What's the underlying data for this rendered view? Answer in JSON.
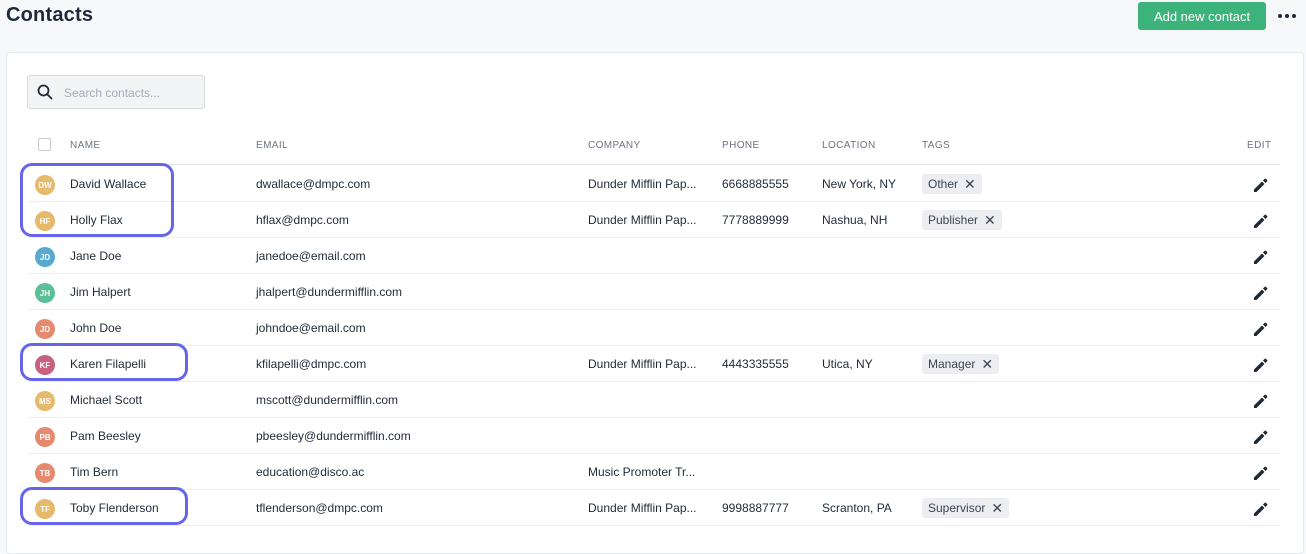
{
  "page": {
    "title": "Contacts"
  },
  "header": {
    "add_button": "Add new contact",
    "more_icon": "ellipsis-icon"
  },
  "search": {
    "placeholder": "Search contacts...",
    "value": "",
    "icon": "search-icon"
  },
  "columns": {
    "name": "NAME",
    "email": "EMAIL",
    "company": "COMPANY",
    "phone": "PHONE",
    "location": "LOCATION",
    "tags": "TAGS",
    "edit": "EDIT"
  },
  "colors": {
    "accent": "#3bb37a",
    "highlight": "#6567e6"
  },
  "contacts": [
    {
      "initials": "DW",
      "name": "David Wallace",
      "email": "dwallace@dmpc.com",
      "company": "Dunder Mifflin Pap...",
      "phone": "6668885555",
      "location": "New York, NY",
      "tag": "Other",
      "avatar_color": "#e7b96a",
      "highlighted": true
    },
    {
      "initials": "HF",
      "name": "Holly Flax",
      "email": "hflax@dmpc.com",
      "company": "Dunder Mifflin Pap...",
      "phone": "7778889999",
      "location": "Nashua, NH",
      "tag": "Publisher",
      "avatar_color": "#e7b96a",
      "highlighted": true
    },
    {
      "initials": "JD",
      "name": "Jane Doe",
      "email": "janedoe@email.com",
      "company": "",
      "phone": "",
      "location": "",
      "tag": "",
      "avatar_color": "#58a9cf",
      "highlighted": false
    },
    {
      "initials": "JH",
      "name": "Jim Halpert",
      "email": "jhalpert@dundermifflin.com",
      "company": "",
      "phone": "",
      "location": "",
      "tag": "",
      "avatar_color": "#5bbf97",
      "highlighted": false
    },
    {
      "initials": "JD",
      "name": "John Doe",
      "email": "johndoe@email.com",
      "company": "",
      "phone": "",
      "location": "",
      "tag": "",
      "avatar_color": "#e58a6e",
      "highlighted": false
    },
    {
      "initials": "KF",
      "name": "Karen Filapelli",
      "email": "kfilapelli@dmpc.com",
      "company": "Dunder Mifflin Pap...",
      "phone": "4443335555",
      "location": "Utica, NY",
      "tag": "Manager",
      "avatar_color": "#c8617e",
      "highlighted": true
    },
    {
      "initials": "MS",
      "name": "Michael Scott",
      "email": "mscott@dundermifflin.com",
      "company": "",
      "phone": "",
      "location": "",
      "tag": "",
      "avatar_color": "#e7b96a",
      "highlighted": false
    },
    {
      "initials": "PB",
      "name": "Pam Beesley",
      "email": "pbeesley@dundermifflin.com",
      "company": "",
      "phone": "",
      "location": "",
      "tag": "",
      "avatar_color": "#e58a6e",
      "highlighted": false
    },
    {
      "initials": "TB",
      "name": "Tim Bern",
      "email": "education@disco.ac",
      "company": "Music Promoter Tr...",
      "phone": "",
      "location": "",
      "tag": "",
      "avatar_color": "#e58a6e",
      "highlighted": false
    },
    {
      "initials": "TF",
      "name": "Toby Flenderson",
      "email": "tflenderson@dmpc.com",
      "company": "Dunder Mifflin Pap...",
      "phone": "9998887777",
      "location": "Scranton, PA",
      "tag": "Supervisor",
      "avatar_color": "#e7b96a",
      "highlighted": true
    }
  ]
}
